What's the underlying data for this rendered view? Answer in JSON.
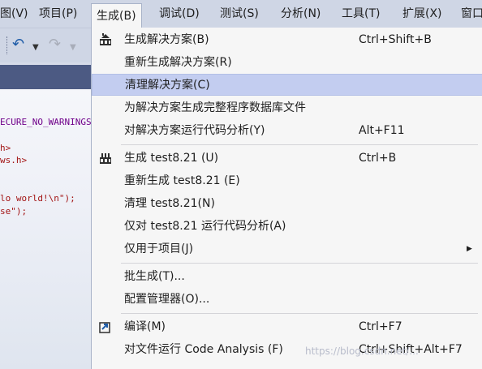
{
  "menubar": {
    "items": [
      "视图(V)",
      "项目(P)",
      "生成(B)",
      "调试(D)",
      "测试(S)",
      "分析(N)",
      "工具(T)",
      "扩展(X)",
      "窗口"
    ],
    "visible_items": [
      "图(V)",
      "项目(P)",
      "生成(B)",
      "调试(D)",
      "测试(S)",
      "分析(N)",
      "工具(T)",
      "扩展(X)",
      "窗口"
    ],
    "active": "生成(B)"
  },
  "editor": {
    "lines": [
      "ECURE_NO_WARNINGS",
      "h>",
      "ws.h>",
      "lo world!\\n\");",
      "se\");"
    ]
  },
  "menu": {
    "items": [
      {
        "label": "生成解决方案(B)",
        "shortcut": "Ctrl+Shift+B",
        "icon": "build-solution-icon"
      },
      {
        "label": "重新生成解决方案(R)",
        "shortcut": ""
      },
      {
        "label": "清理解决方案(C)",
        "shortcut": "",
        "highlighted": true
      },
      {
        "label": "为解决方案生成完整程序数据库文件",
        "shortcut": ""
      },
      {
        "label": "对解决方案运行代码分析(Y)",
        "shortcut": "Alt+F11"
      },
      {
        "label": "生成 test8.21 (U)",
        "shortcut": "Ctrl+B",
        "icon": "build-project-icon"
      },
      {
        "label": "重新生成 test8.21 (E)",
        "shortcut": ""
      },
      {
        "label": "清理 test8.21(N)",
        "shortcut": ""
      },
      {
        "label": "仅对 test8.21 运行代码分析(A)",
        "shortcut": ""
      },
      {
        "label": "仅用于项目(J)",
        "shortcut": "",
        "submenu": true
      },
      {
        "label": "批生成(T)...",
        "shortcut": ""
      },
      {
        "label": "配置管理器(O)...",
        "shortcut": ""
      },
      {
        "label": "编译(M)",
        "shortcut": "Ctrl+F7",
        "icon": "compile-icon"
      },
      {
        "label": "对文件运行 Code Analysis (F)",
        "shortcut": "Ctrl+Shift+Alt+F7"
      }
    ]
  },
  "watermark": "https://blog.csdn.net/...",
  "colors": {
    "highlight": "#c3cdf0",
    "menubar": "#cfd6e5",
    "tabbar": "#4c5a83"
  }
}
